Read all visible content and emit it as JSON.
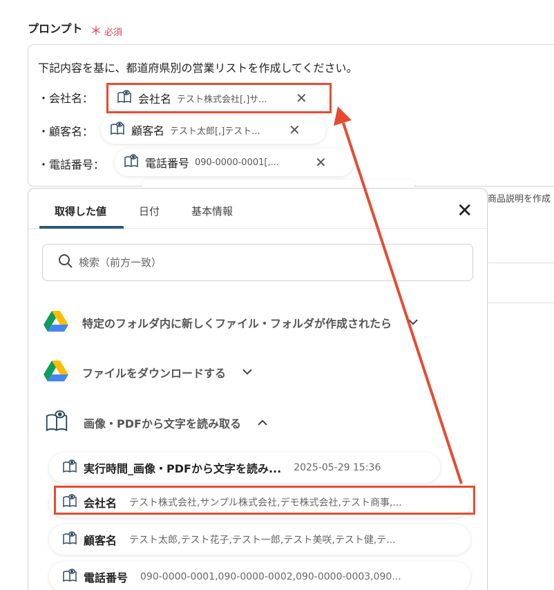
{
  "prompt_field": {
    "label": "プロンプト",
    "required_star": "＊",
    "required_text": "必須",
    "intro_text": "下記内容を基に、都道府県別の営業リストを作成してください。",
    "rows": [
      {
        "label": "・会社名：",
        "chip_name": "会社名",
        "chip_value": "テスト株式会社[,]サ..."
      },
      {
        "label": "・顧客名：",
        "chip_name": "顧客名",
        "chip_value": "テスト太郎[,]テスト..."
      },
      {
        "label": "・電話番号：",
        "chip_name": "電話番号",
        "chip_value": "090-0000-0001[,..."
      }
    ],
    "background_hint": "商品説明を作成"
  },
  "panel": {
    "tabs": [
      "取得した値",
      "日付",
      "基本情報"
    ],
    "active_tab": "取得した値",
    "search_placeholder": "検索（前方一致）",
    "sections": [
      {
        "title": "特定のフォルダ内に新しくファイル・フォルダが作成されたら",
        "icon": "google-drive-icon",
        "expanded": false
      },
      {
        "title": "ファイルをダウンロードする",
        "icon": "google-drive-icon",
        "expanded": false
      },
      {
        "title": "画像・PDFから文字を読み取る",
        "icon": "ocr-book-icon",
        "expanded": true
      }
    ],
    "items": [
      {
        "name": "実行時間_画像・PDFから文字を読み...",
        "value": "2025-05-29 15:36"
      },
      {
        "name": "会社名",
        "value": "テスト株式会社,サンプル株式会社,デモ株式会社,テスト商事,..."
      },
      {
        "name": "顧客名",
        "value": "テスト太郎,テスト花子,テスト一郎,テスト美咲,テスト健,テ..."
      },
      {
        "name": "電話番号",
        "value": "090-0000-0001,090-0000-0002,090-0000-0003,090..."
      }
    ]
  },
  "colors": {
    "highlight": "#e84a2f",
    "required": "#e0414f",
    "tab_underline": "#2c5a7a"
  }
}
